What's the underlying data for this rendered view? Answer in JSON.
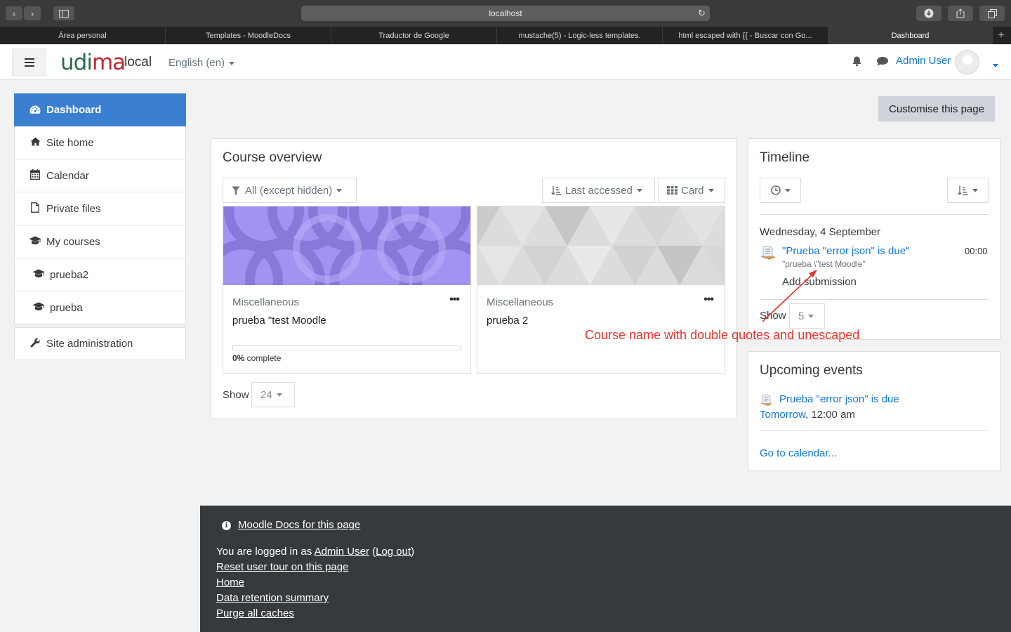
{
  "browser": {
    "address": "localhost",
    "tabs": [
      {
        "label": "Área personal"
      },
      {
        "label": "Templates - MoodleDocs"
      },
      {
        "label": "Traductor de Google"
      },
      {
        "label": "mustache(5) - Logic-less templates."
      },
      {
        "label": "html escaped with {{ - Buscar con Go..."
      },
      {
        "label": "Dashboard"
      }
    ]
  },
  "navbar": {
    "brand_prefix": "udi",
    "brand_suffix": "ma",
    "brand_local": "local",
    "language": "English (en)",
    "user_name": "Admin User"
  },
  "sidebar": {
    "items": [
      {
        "label": "Dashboard",
        "icon": "dashboard-icon"
      },
      {
        "label": "Site home",
        "icon": "home-icon"
      },
      {
        "label": "Calendar",
        "icon": "calendar-icon"
      },
      {
        "label": "Private files",
        "icon": "file-icon"
      },
      {
        "label": "My courses",
        "icon": "graduation-cap-icon"
      },
      {
        "label": "prueba2",
        "icon": "graduation-cap-icon"
      },
      {
        "label": "prueba",
        "icon": "graduation-cap-icon"
      }
    ],
    "admin": {
      "label": "Site administration",
      "icon": "wrench-icon"
    }
  },
  "main": {
    "customise_label": "Customise this page",
    "course_overview": {
      "title": "Course overview",
      "filter": "All (except hidden)",
      "sort": "Last accessed",
      "view": "Card",
      "courses": [
        {
          "category": "Miscellaneous",
          "name": "prueba \"test Moodle",
          "progress_percent": "0%",
          "progress_suffix": " complete",
          "progress_value": 0
        },
        {
          "category": "Miscellaneous",
          "name": "prueba 2"
        }
      ],
      "show_label": "Show",
      "show_value": "24"
    },
    "timeline": {
      "title": "Timeline",
      "date": "Wednesday, 4 September",
      "event_link": "\"Prueba \"error json\" is due\"",
      "event_course": "\"prueba \\\"test Moodle\"",
      "event_time": "00:00",
      "event_action": "Add submission",
      "show_label": "Show",
      "show_value": "5"
    },
    "upcoming": {
      "title": "Upcoming events",
      "event_link": "Prueba \"error json\" is due",
      "event_day": "Tomorrow",
      "event_time": ", 12:00 am",
      "calendar_link": "Go to calendar..."
    }
  },
  "annotation": "Course name with double quotes and unescaped",
  "footer": {
    "docs_link": "Moodle Docs for this page",
    "logged_prefix": "You are logged in as ",
    "logged_user": "Admin User",
    "logout_open": " (",
    "logout": "Log out",
    "logout_close": ")",
    "links": [
      "Reset user tour on this page",
      "Home",
      "Data retention summary",
      "Purge all caches"
    ]
  },
  "colors": {
    "accent": "#3b7fd1",
    "link": "#1177d1",
    "footer_bg": "#373a3c",
    "annotation": "#e5332a"
  }
}
